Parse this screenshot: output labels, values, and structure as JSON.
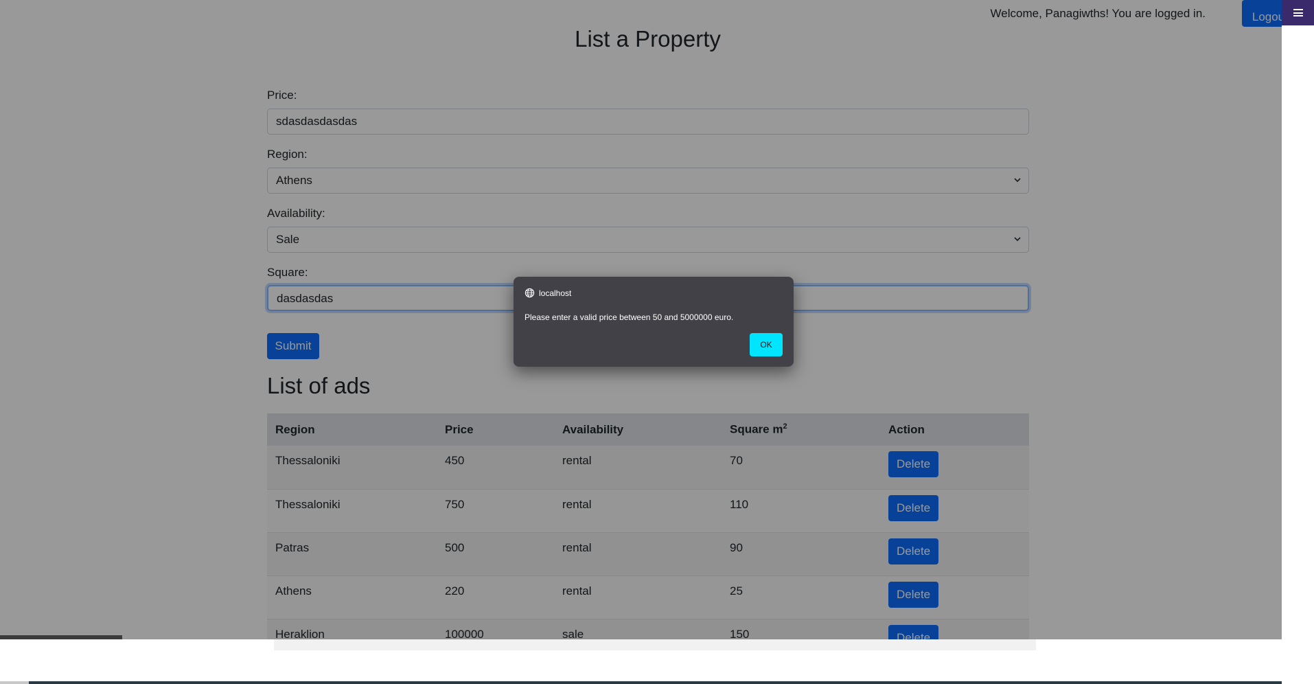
{
  "header": {
    "welcome_text": "Welcome, Panagiwths! You are logged in.",
    "logout_label": "Logou"
  },
  "page_title": "List a Property",
  "form": {
    "price_label": "Price:",
    "price_value": "sdasdasdasdas",
    "region_label": "Region:",
    "region_value": "Athens",
    "availability_label": "Availability:",
    "availability_value": "Sale",
    "square_label": "Square:",
    "square_value": "dasdasdas",
    "submit_label": "Submit"
  },
  "list_title": "List of ads",
  "table": {
    "headers": {
      "region": "Region",
      "price": "Price",
      "availability": "Availability",
      "square": "Square m",
      "square_sup": "2",
      "action": "Action"
    },
    "rows": [
      {
        "region": "Thessaloniki",
        "price": "450",
        "availability": "rental",
        "square": "70",
        "action": "Delete"
      },
      {
        "region": "Thessaloniki",
        "price": "750",
        "availability": "rental",
        "square": "110",
        "action": "Delete"
      },
      {
        "region": "Patras",
        "price": "500",
        "availability": "rental",
        "square": "90",
        "action": "Delete"
      },
      {
        "region": "Athens",
        "price": "220",
        "availability": "rental",
        "square": "25",
        "action": "Delete"
      },
      {
        "region": "Heraklion",
        "price": "100000",
        "availability": "sale",
        "square": "150",
        "action": "Delete"
      }
    ]
  },
  "dialog": {
    "origin": "localhost",
    "message": "Please enter a valid price between 50 and 5000000 euro.",
    "ok_label": "OK"
  },
  "icons": {
    "menu": "hamburger-menu-icon",
    "globe": "globe-icon",
    "chevron": "chevron-down-icon"
  },
  "colors": {
    "primary": "#0d6efd",
    "dialog_bg": "#434148",
    "dialog_ok": "#00e5ff",
    "menu_bg": "#3a2a6b"
  }
}
